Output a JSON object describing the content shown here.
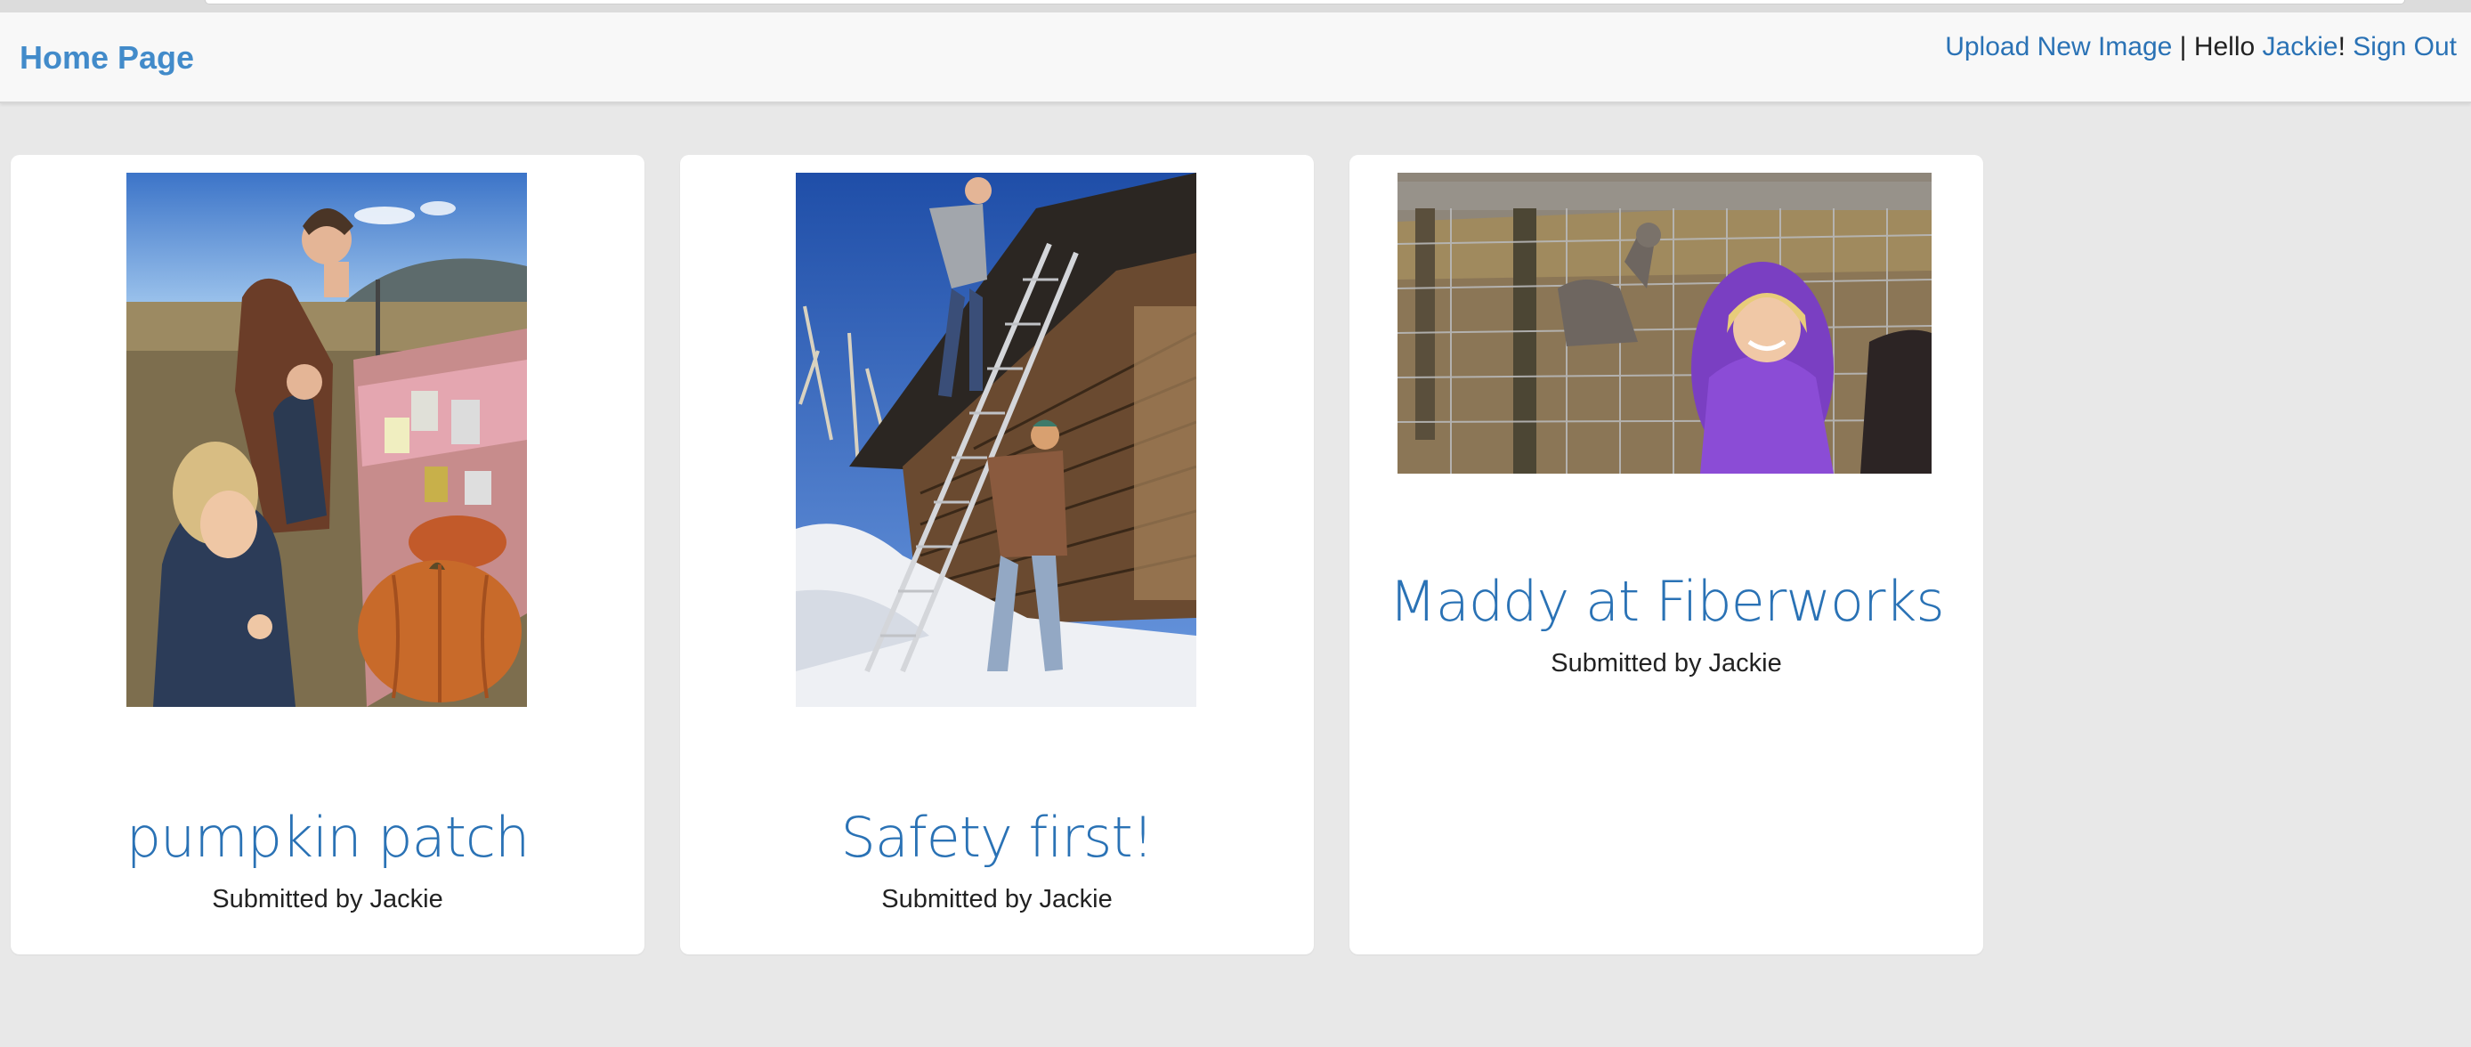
{
  "navbar": {
    "brand": "Home Page",
    "upload_link": "Upload New Image",
    "separator": "|",
    "hello_prefix": "Hello",
    "username": "Jackie",
    "exclaim": "!",
    "sign_out": "Sign Out"
  },
  "images": [
    {
      "title": "pumpkin patch",
      "submitted": "Submitted by Jackie"
    },
    {
      "title": "Safety first!",
      "submitted": "Submitted by Jackie"
    },
    {
      "title": "Maddy at Fiberworks",
      "submitted": "Submitted by Jackie"
    }
  ],
  "colors": {
    "link": "#2a72b5",
    "brand": "#428bca",
    "page_bg": "#e8e8e8",
    "card_bg": "#ffffff"
  }
}
